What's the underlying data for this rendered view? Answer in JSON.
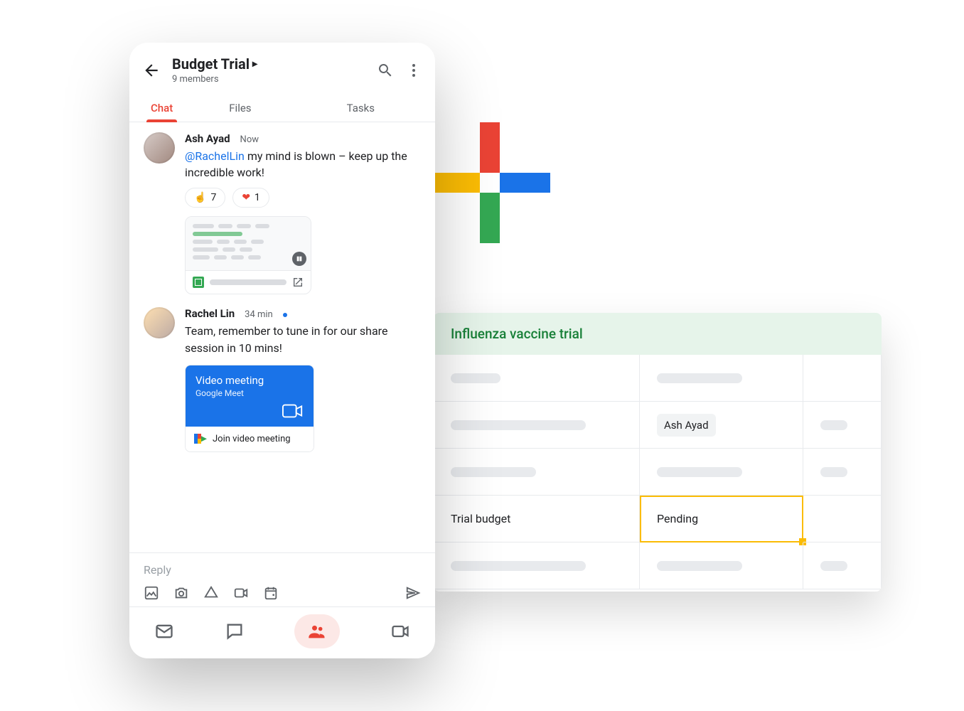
{
  "colors": {
    "red": "#ea4335",
    "blue": "#1a73e8",
    "green": "#34a853",
    "yellow": "#fbbc04"
  },
  "phone": {
    "header": {
      "title": "Budget Trial",
      "subtitle": "9 members"
    },
    "tabs": {
      "chat": "Chat",
      "files": "Files",
      "tasks": "Tasks"
    },
    "messages": [
      {
        "author": "Ash Ayad",
        "time": "Now",
        "mention": "@RachelLin",
        "text_rest": " my mind is blown – keep up the incredible work!",
        "reactions": {
          "point": "☝️",
          "point_count": "7",
          "heart": "❤",
          "heart_count": "1"
        }
      },
      {
        "author": "Rachel Lin",
        "time": "34 min",
        "text": "Team, remember to tune in for our share session in 10 mins!",
        "meet": {
          "title": "Video meeting",
          "subtitle": "Google Meet",
          "cta": "Join video meeting"
        }
      }
    ],
    "reply_placeholder": "Reply"
  },
  "sheet": {
    "title": "Influenza vaccine trial",
    "cells": {
      "r2c2": "Ash Ayad",
      "r4c1": "Trial budget",
      "r4c2": "Pending"
    }
  }
}
